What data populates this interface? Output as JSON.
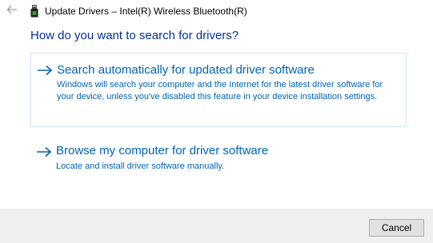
{
  "window": {
    "title": "Update Drivers – Intel(R) Wireless Bluetooth(R)",
    "back_icon": "back-arrow-icon",
    "device_icon": "usb-device-icon"
  },
  "heading": "How do you want to search for drivers?",
  "options": [
    {
      "title": "Search automatically for updated driver software",
      "description": "Windows will search your computer and the Internet for the latest driver software for your device, unless you've disabled this feature in your device installation settings.",
      "icon": "arrow-right-icon",
      "selected": true
    },
    {
      "title": "Browse my computer for driver software",
      "description": "Locate and install driver software manually.",
      "icon": "arrow-right-icon",
      "selected": false
    }
  ],
  "footer": {
    "cancel_label": "Cancel"
  },
  "colors": {
    "heading": "#003399",
    "link": "#0063b1",
    "selected_border": "#cce4f7",
    "footer_bg": "#f0f0f0"
  }
}
